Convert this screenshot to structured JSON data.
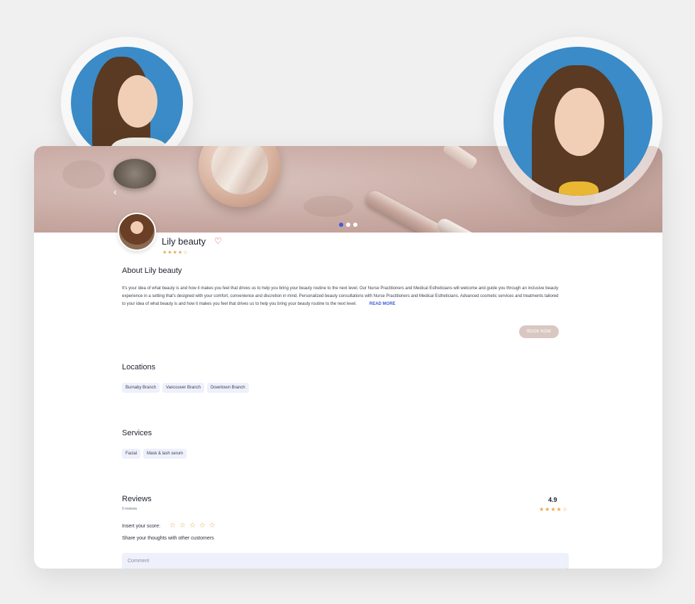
{
  "profile": {
    "name": "Lily beauty",
    "stars": "★★★★☆",
    "heart": "♡"
  },
  "hero": {
    "prev_arrow": "‹",
    "slides": 3,
    "active_slide": 1
  },
  "about": {
    "title": "About Lily beauty",
    "text": "It's your idea of what beauty is and how it makes you feel that drives us to help you bring your beauty routine to the next level. Our Nurse Practitioners and Medical Estheticians will welcome and guide you through an inclusive beauty experience in a setting that's designed with your comfort, convenience and discretion in mind. Personalized beauty consultations with Nurse Practitioners and Medical Estheticians. Advanced cosmetic services and treatments tailored to your idea of what beauty is and how it makes you feel that drives us to help you bring your beauty routine to the next level.",
    "read_more": "READ MORE",
    "book_now": "BOOK NOW"
  },
  "locations": {
    "title": "Locations",
    "items": [
      "Burnaby Branch",
      "Vancouver Branch",
      "Downtown Branch"
    ]
  },
  "services": {
    "title": "Services",
    "items": [
      "Facial",
      "Mask & lash serum"
    ]
  },
  "reviews": {
    "title": "Reviews",
    "count_label": "0 reviews",
    "rating": "4.9",
    "rating_stars": "★★★★☆",
    "score_label": "Insert your score:",
    "score_star": "☆",
    "share_label": "Share your thoughts with other customers",
    "comment_placeholder": "Comment"
  },
  "colors": {
    "accent": "#3f5bd8",
    "star": "#e8a64a",
    "chip_bg": "#eef0fb",
    "book_btn": "#d9c7c2",
    "heart": "#e0454f"
  }
}
